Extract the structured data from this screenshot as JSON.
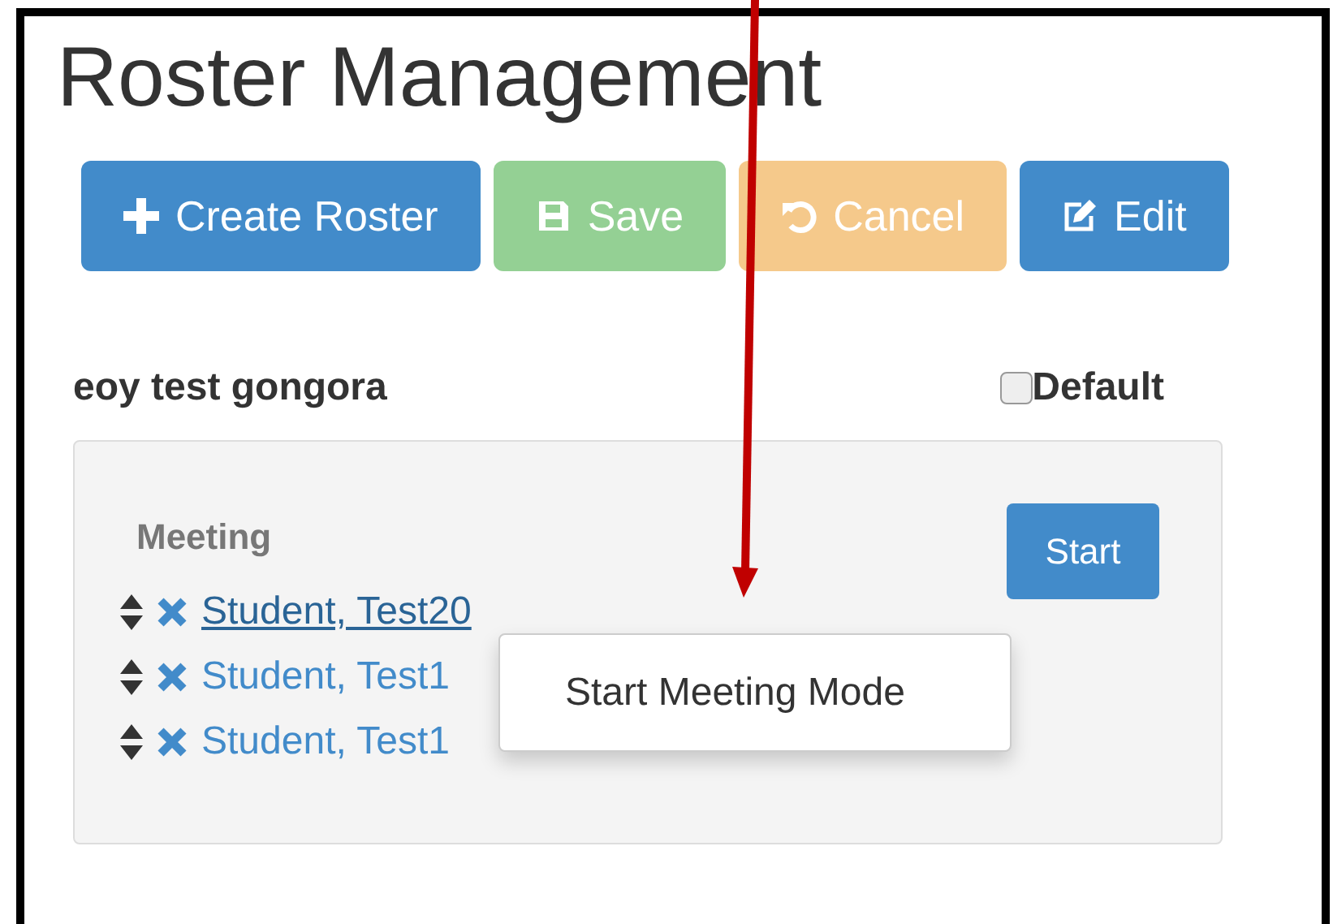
{
  "title": "Roster Management",
  "buttons": [
    {
      "label": "Create Roster",
      "kind": "add",
      "disabled": false
    },
    {
      "label": "Save",
      "kind": "save",
      "disabled": true
    },
    {
      "label": "Cancel",
      "kind": "undo",
      "disabled": true
    },
    {
      "label": "Edit",
      "kind": "edit",
      "disabled": false
    }
  ],
  "roster": {
    "name": "eoy test gongora",
    "default": {
      "label": "Default",
      "checked": false
    },
    "section": {
      "label": "Meeting",
      "start_button": "Start",
      "students": [
        {
          "name": "Student, Test20",
          "hovered": true
        },
        {
          "name": "Student, Test1",
          "hovered": false
        },
        {
          "name": "Student, Test1",
          "hovered": false
        }
      ]
    }
  },
  "tooltip": {
    "text": "Start Meeting Mode"
  }
}
